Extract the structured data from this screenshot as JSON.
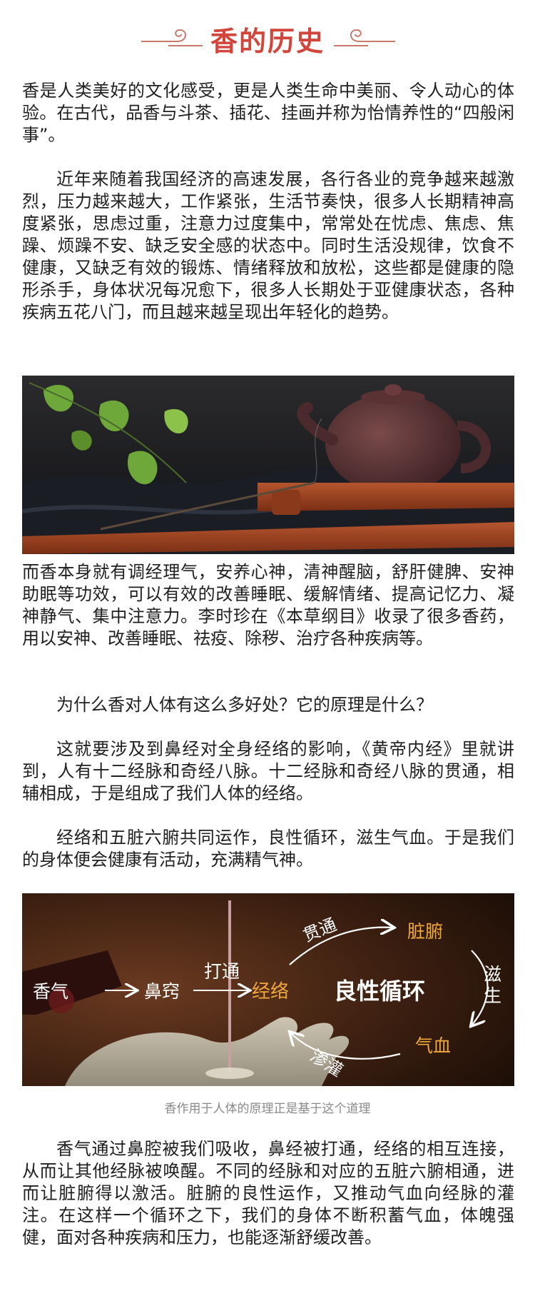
{
  "header": {
    "title": "香的历史"
  },
  "paragraphs": {
    "p1": "香是人类美好的文化感受，更是人类生命中美丽、令人动心的体验。在古代，品香与斗茶、插花、挂画并称为怡情养性的“四般闲事”。",
    "p2": "近年来随着我国经济的高速发展，各行各业的竞争越来越激烈，压力越来越大，工作紧张，生活节奏快，很多人长期精神高度紧张，思虑过重，注意力过度集中，常常处在忧虑、焦虑、焦躁、烦躁不安、缺乏安全感的状态中。同时生活没规律，饮食不健康，又缺乏有效的锻炼、情绪释放和放松，这些都是健康的隐形杀手，身体状况每况愈下，很多人长期处于亚健康状态，各种疾病五花八门，而且越来越呈现出年轻化的趋势。",
    "p3": "而香本身就有调经理气，安养心神，清神醒脑，舒肝健脾、安神助眠等功效，可以有效的改善睡眠、缓解情绪、提高记忆力、凝神静气、集中注意力。李时珍在《本草纲目》收录了很多香药，用以安神、改善睡眠、祛疫、除秽、治疗各种疾病等。",
    "p4": "为什么香对人体有这么多好处？它的原理是什么？",
    "p5": "这就要涉及到鼻经对全身经络的影响，《黄帝内经》里就讲到，人有十二经脉和奇经八脉。十二经脉和奇经八脉的贯通，相辅相成，于是组成了我们人体的经络。",
    "p6": "经络和五脏六腑共同运作，良性循环，滋生气血。于是我们的身体便会健康有活动，充满精气神。",
    "p7": "香气通过鼻腔被我们吸收，鼻经被打通，经络的相互连接，从而让其他经脉被唤醒。不同的经脉和对应的五脏六腑相通，进而让脏腑得以激活。脏腑的良性运作，又推动气血向经脉的灌注。在这样一个循环之下，我们的身体不断积蓄气血，体魄强健，面对各种疾病和压力，也能逐渐舒缓改善。"
  },
  "diagram": {
    "xiangqi": "香气",
    "biqiao": "鼻窍",
    "datong": "打通",
    "jingluo": "经络",
    "center": "良性循环",
    "guantong": "贯通",
    "zangfu": "脏腑",
    "zisheng": "滋生",
    "qixue": "气血",
    "shenguan": "渗灌"
  },
  "caption": "香作用于人体的原理正是基于这个道理",
  "colors": {
    "title": "#d2453a",
    "ornament": "#c97a6a",
    "highlight": "#f2a93b"
  }
}
